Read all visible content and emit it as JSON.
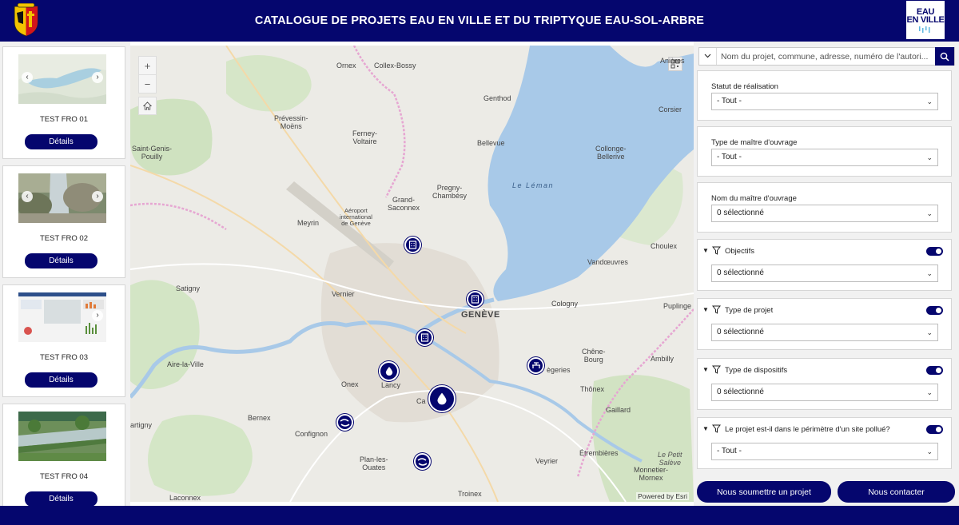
{
  "header": {
    "title": "CATALOGUE DE PROJETS EAU EN VILLE ET DU TRIPTYQUE EAU-SOL-ARBRE"
  },
  "logo": {
    "line1": "EAU",
    "line2": "EN VILLE"
  },
  "projects": [
    {
      "title": "TEST FRO 01",
      "details_label": "Détails"
    },
    {
      "title": "TEST FRO 02",
      "details_label": "Détails"
    },
    {
      "title": "TEST FRO 03",
      "details_label": "Détails"
    },
    {
      "title": "TEST FRO 04",
      "details_label": "Détails"
    }
  ],
  "map": {
    "zoom_in": "+",
    "zoom_out": "−",
    "attribution": "Powered by Esri",
    "labels": {
      "ornex": "Ornex",
      "collex": "Collex-Bossy",
      "prevessin": "Prévessin-\nMoëns",
      "ferney": "Ferney-\nVoltaire",
      "genthod": "Genthod",
      "bellevue": "Bellevue",
      "saintgenis": "Saint-Genis-\nPouilly",
      "grandsaconnex": "Grand-\nSaconnex",
      "pregny": "Pregny-\nChambésy",
      "meyrin": "Meyrin",
      "aeroport": "Aéroport\ninternational\nde Genève",
      "leman": "Le Léman",
      "collonge": "Collonge-\nBellerive",
      "corsier": "Corsier",
      "anieres": "Anières",
      "choulex": "Choulex",
      "vandoeuvres": "Vandœuvres",
      "satigny": "Satigny",
      "vernier": "Vernier",
      "geneve": "GENÈVE",
      "cologny": "Cologny",
      "puplinge": "Puplinge",
      "chenebourg": "Chêne-\nBourg",
      "ambilly": "Ambilly",
      "airelaville": "Aire-la-Ville",
      "onex": "Onex",
      "lancy": "Lancy",
      "carouge": "Ca",
      "genieres": "ègeries",
      "thonex": "Thônex",
      "bernex": "Bernex",
      "confignon": "Confignon",
      "gaillard": "Gaillard",
      "cartigny": "artigny",
      "planlesouates": "Plan-les-\nOuates",
      "veyrier": "Veyrier",
      "etrembieres": "Étrembières",
      "petitsaleve": "Le Petit\nSalève",
      "monnetier": "Monnetier-\nMornex",
      "laconnex": "Laconnex",
      "troinex": "Troinex"
    }
  },
  "search": {
    "placeholder": "Nom du projet, commune, adresse, numéro de l'autori..."
  },
  "filters": [
    {
      "label": "Statut de réalisation",
      "value": "- Tout -"
    },
    {
      "label": "Type de maître d'ouvrage",
      "value": "- Tout -"
    },
    {
      "label": "Nom du maître d'ouvrage",
      "value": "0 sélectionné"
    },
    {
      "label": "Objectifs",
      "value": "0 sélectionné"
    },
    {
      "label": "Type de projet",
      "value": "0 sélectionné"
    },
    {
      "label": "Type de dispositifs",
      "value": "0 sélectionné"
    },
    {
      "label": "Le projet est-il dans le périmètre d'un site pollué?",
      "value": "- Tout -"
    }
  ],
  "actions": {
    "submit": "Nous soumettre un projet",
    "contact": "Nous contacter"
  },
  "colors": {
    "brand": "#05066e",
    "lake": "#a8c9e8",
    "land": "#ecebe6"
  }
}
